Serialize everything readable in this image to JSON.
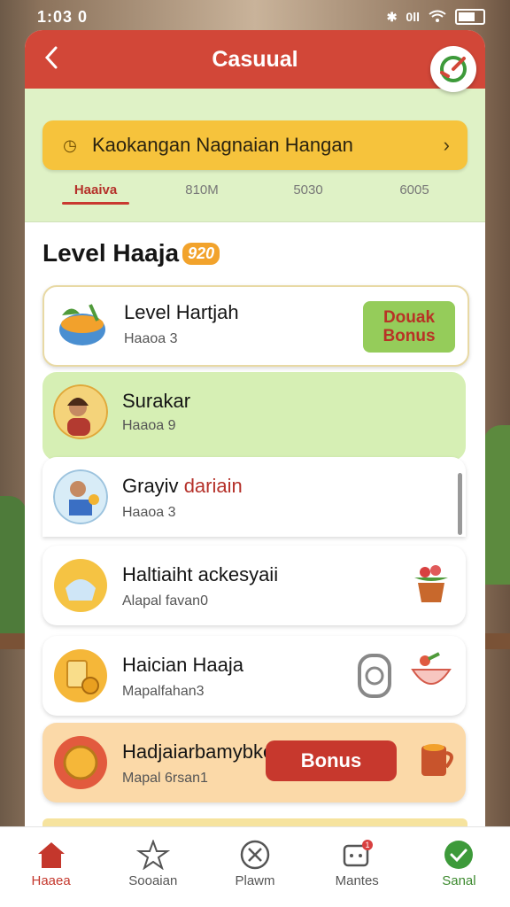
{
  "status_bar": {
    "time": "1:03 0",
    "signal_text": "0ll"
  },
  "header": {
    "title": "Casuual"
  },
  "promo": {
    "text": "Kaokangan Nagnaian Hangan"
  },
  "tabs": [
    {
      "label": "Haaiva"
    },
    {
      "label": "810M"
    },
    {
      "label": "5030"
    },
    {
      "label": "6005"
    }
  ],
  "section": {
    "title": "Level Haaja",
    "badge": "920"
  },
  "cards": [
    {
      "title": "Level Hartjah",
      "subtitle": "Haaoa 3",
      "action": "Douak Bonus"
    },
    {
      "title": "Surakar",
      "subtitle": "Haaoa 9"
    },
    {
      "title_a": "Grayiv ",
      "title_b": "dariain",
      "subtitle": "Haaoa 3"
    },
    {
      "title": "Haltiaiht ackesyaii",
      "subtitle": "Alapal favan0"
    },
    {
      "title": "Haician Haaja",
      "subtitle": "Mapalfahan3"
    },
    {
      "title": "Hadjaiarbamybke",
      "subtitle": "Mapal 6rsan1",
      "action": "Bonus"
    }
  ],
  "nav": [
    {
      "label": "Haaea"
    },
    {
      "label": "Sooaian"
    },
    {
      "label": "Plawm"
    },
    {
      "label": "Mantes",
      "badge": "1"
    },
    {
      "label": "Sanal"
    }
  ],
  "colors": {
    "brand": "#d24738",
    "promo": "#f6c33c",
    "success": "#3d8a2f",
    "panel": "#dff2c6"
  }
}
